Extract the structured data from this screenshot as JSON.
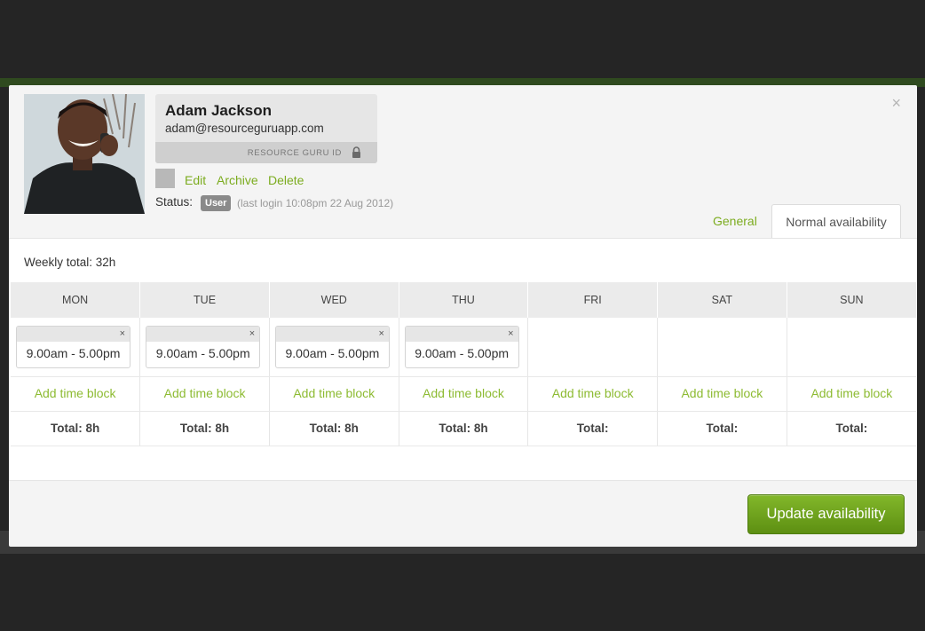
{
  "modal": {
    "close_label": "×"
  },
  "profile": {
    "name": "Adam Jackson",
    "email": "adam@resourceguruapp.com",
    "id_label": "RESOURCE GURU ID",
    "actions": [
      "Edit",
      "Archive",
      "Delete"
    ],
    "status_label": "Status:",
    "status_badge": "User",
    "last_login": "(last login 10:08pm 22 Aug 2012)"
  },
  "tabs": [
    {
      "label": "General",
      "active": false
    },
    {
      "label": "Normal availability",
      "active": true
    }
  ],
  "availability": {
    "weekly_total": "Weekly total: 32h",
    "days": [
      {
        "name": "MON",
        "block": "9.00am - 5.00pm",
        "add_label": "Add time block",
        "total": "Total: 8h"
      },
      {
        "name": "TUE",
        "block": "9.00am - 5.00pm",
        "add_label": "Add time block",
        "total": "Total: 8h"
      },
      {
        "name": "WED",
        "block": "9.00am - 5.00pm",
        "add_label": "Add time block",
        "total": "Total: 8h"
      },
      {
        "name": "THU",
        "block": "9.00am - 5.00pm",
        "add_label": "Add time block",
        "total": "Total: 8h"
      },
      {
        "name": "FRI",
        "block": null,
        "add_label": "Add time block",
        "total": "Total:"
      },
      {
        "name": "SAT",
        "block": null,
        "add_label": "Add time block",
        "total": "Total:"
      },
      {
        "name": "SUN",
        "block": null,
        "add_label": "Add time block",
        "total": "Total:"
      }
    ],
    "block_close_label": "×"
  },
  "footer": {
    "update_button_label": "Update availability"
  },
  "colors": {
    "accent_link": "#7cac1f",
    "primary_button": "#6fa21d",
    "badge": "#8a8a8a"
  },
  "icons": {
    "lock": "lock-icon",
    "close": "close-icon",
    "block_close": "close-icon"
  }
}
